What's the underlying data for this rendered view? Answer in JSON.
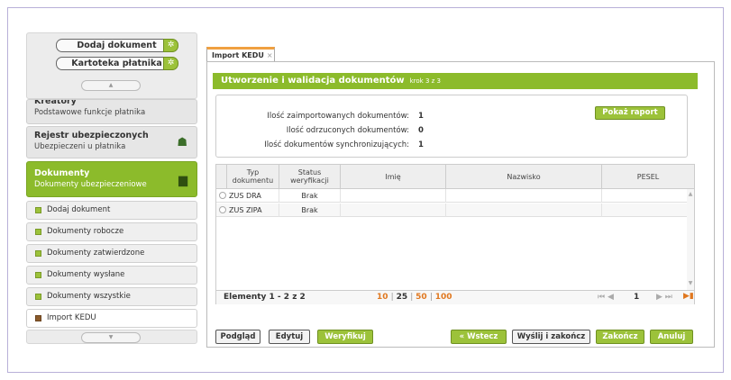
{
  "sidebar": {
    "quick_actions": [
      "Dodaj dokument",
      "Kartoteka płatnika"
    ],
    "sections": [
      {
        "title": "Kreatory",
        "subtitle": "Podstawowe funkcje płatnika"
      },
      {
        "title": "Rejestr ubezpieczonych",
        "subtitle": "Ubezpieczeni u płatnika"
      },
      {
        "title": "Dokumenty",
        "subtitle": "Dokumenty ubezpieczeniowe"
      }
    ],
    "items": [
      "Dodaj dokument",
      "Dokumenty robocze",
      "Dokumenty zatwierdzone",
      "Dokumenty wysłane",
      "Dokumenty wszystkie",
      "Import KEDU"
    ]
  },
  "tab": {
    "label": "Import KEDU",
    "close": "×"
  },
  "panel": {
    "title": "Utworzenie i walidacja dokumentów",
    "step": "krok 3 z 3"
  },
  "summary": {
    "rows": [
      {
        "label": "Ilość zaimportowanych dokumentów:",
        "value": "1"
      },
      {
        "label": "Ilość odrzuconych dokumentów:",
        "value": "0"
      },
      {
        "label": "Ilość dokumentów synchronizujących:",
        "value": "1"
      }
    ],
    "report_button": "Pokaż raport"
  },
  "grid": {
    "columns": [
      "Typ dokumentu",
      "Status weryfikacji",
      "Imię",
      "Nazwisko",
      "PESEL"
    ],
    "rows": [
      {
        "type": "ZUS DRA",
        "status": "Brak"
      },
      {
        "type": "ZUS ZIPA",
        "status": "Brak"
      }
    ],
    "footer": {
      "count": "Elementy 1 - 2 z 2",
      "page_sizes": [
        "10",
        "25",
        "50",
        "100"
      ],
      "current_page": "1"
    }
  },
  "buttons": {
    "preview": "Podgląd",
    "edit": "Edytuj",
    "verify": "Weryfikuj",
    "back": "« Wstecz",
    "send_finish": "Wyślij i zakończ",
    "finish": "Zakończ",
    "cancel": "Anuluj"
  },
  "colors": {
    "accent": "#8cbb2b",
    "orange": "#e07820",
    "frame": "#b8b0d8"
  }
}
